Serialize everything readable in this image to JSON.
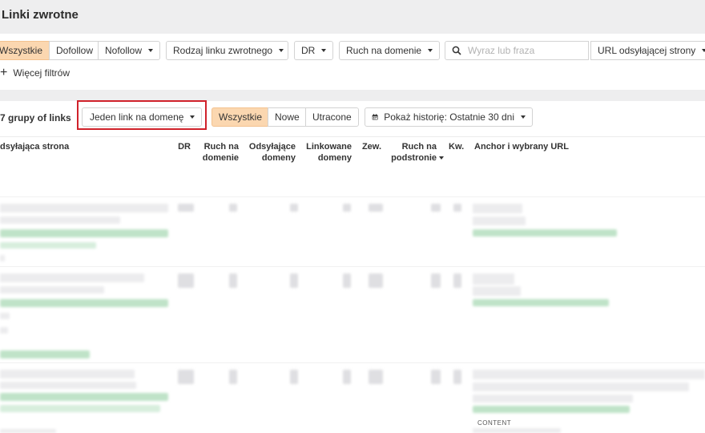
{
  "header": {
    "title": "Linki zwrotne"
  },
  "filters": {
    "link_type": [
      "Wszystkie",
      "Dofollow",
      "Nofollow"
    ],
    "link_type_active": "Wszystkie",
    "backlink_kind_label": "Rodzaj linku zwrotnego",
    "dr_label": "DR",
    "domain_traffic_label": "Ruch na domenie",
    "search_placeholder": "Wyraz lub fraza",
    "search_value": "",
    "search_scope_label": "URL odsyłającej strony",
    "more_filters_label": "Więcej filtrów"
  },
  "toolbar": {
    "groups_label": "7 grupy of links",
    "grouping_label": "Jeden link na domenę",
    "status_tabs": [
      "Wszystkie",
      "Nowe",
      "Utracone"
    ],
    "status_active": "Wszystkie",
    "history_label": "Pokaż historię: Ostatnie 30 dni"
  },
  "table": {
    "columns": {
      "referring_page": "dsyłająca strona",
      "dr": "DR",
      "domain_traffic": [
        "Ruch na",
        "domenie"
      ],
      "referring_domains": [
        "Odsyłające",
        "domeny"
      ],
      "linked_domains": [
        "Linkowane",
        "domeny"
      ],
      "external": "Zew.",
      "page_traffic": [
        "Ruch na",
        "podstronie"
      ],
      "keywords": "Kw.",
      "anchor": "Anchor i wybrany URL"
    },
    "content_tag": "CONTENT"
  },
  "colors": {
    "active_chip": "#fbd7b0",
    "highlight": "#d0222b",
    "band": "#eeeeef"
  }
}
